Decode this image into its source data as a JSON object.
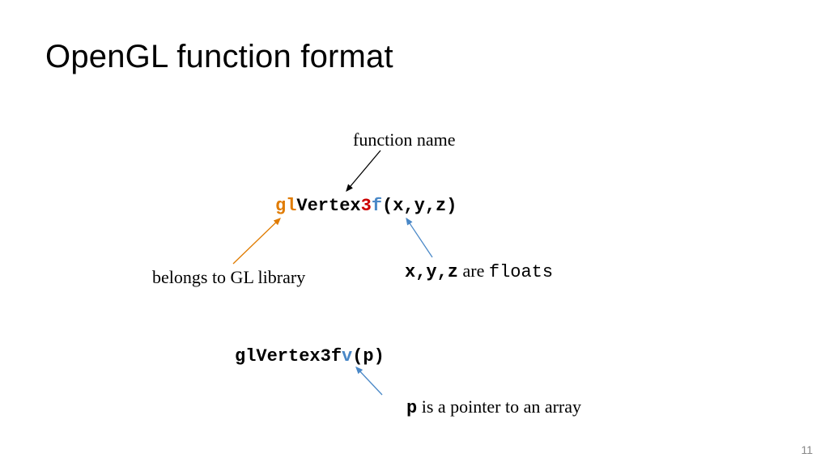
{
  "title": "OpenGL function format",
  "labels": {
    "function_name": "function name",
    "belongs": "belongs to GL library",
    "xyz_bold": "x,y,z",
    "xyz_are": " are ",
    "xyz_floats": "floats",
    "p_bold": "p",
    "p_rest": " is a pointer to an array"
  },
  "code1": {
    "gl": "gl",
    "vertex": "Vertex",
    "three": "3",
    "f": "f",
    "args": "(x,y,z)"
  },
  "code2": {
    "prefix": "glVertex3f",
    "v": "v",
    "args": "(p)"
  },
  "colors": {
    "orange": "#e07b00",
    "red": "#cc0000",
    "blue": "#4a88c7",
    "arrow_black": "#000000"
  },
  "page_number": "11"
}
